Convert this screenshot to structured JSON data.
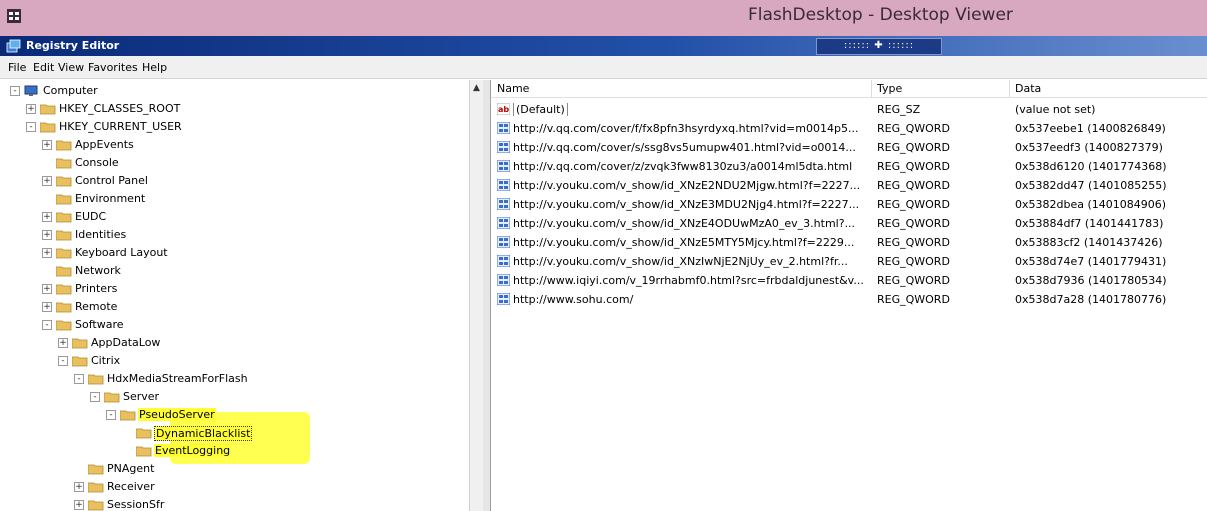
{
  "viewer": {
    "title": "FlashDesktop - Desktop Viewer",
    "controls": ":::::: ✚ ::::::"
  },
  "window": {
    "title": "Registry Editor"
  },
  "menu": [
    "File",
    "Edit",
    "View",
    "Favorites",
    "Help"
  ],
  "tree": [
    {
      "label": "Computer",
      "expander": "-",
      "level": 0,
      "icon": "computer-icon"
    },
    {
      "label": "HKEY_CLASSES_ROOT",
      "expander": "+",
      "level": 1
    },
    {
      "label": "HKEY_CURRENT_USER",
      "expander": "-",
      "level": 1
    },
    {
      "label": "AppEvents",
      "expander": "+",
      "level": 2
    },
    {
      "label": "Console",
      "expander": "",
      "level": 2
    },
    {
      "label": "Control Panel",
      "expander": "+",
      "level": 2
    },
    {
      "label": "Environment",
      "expander": "",
      "level": 2
    },
    {
      "label": "EUDC",
      "expander": "+",
      "level": 2
    },
    {
      "label": "Identities",
      "expander": "+",
      "level": 2
    },
    {
      "label": "Keyboard Layout",
      "expander": "+",
      "level": 2
    },
    {
      "label": "Network",
      "expander": "",
      "level": 2
    },
    {
      "label": "Printers",
      "expander": "+",
      "level": 2
    },
    {
      "label": "Remote",
      "expander": "+",
      "level": 2
    },
    {
      "label": "Software",
      "expander": "-",
      "level": 2
    },
    {
      "label": "AppDataLow",
      "expander": "+",
      "level": 3
    },
    {
      "label": "Citrix",
      "expander": "-",
      "level": 3
    },
    {
      "label": "HdxMediaStreamForFlash",
      "expander": "-",
      "level": 4
    },
    {
      "label": "Server",
      "expander": "-",
      "level": 5
    },
    {
      "label": "PseudoServer",
      "expander": "-",
      "level": 6,
      "highlight": true
    },
    {
      "label": "DynamicBlacklist",
      "expander": "",
      "level": 7,
      "highlight": true,
      "selected": true
    },
    {
      "label": "EventLogging",
      "expander": "",
      "level": 7,
      "highlight": true
    },
    {
      "label": "PNAgent",
      "expander": "",
      "level": 4
    },
    {
      "label": "Receiver",
      "expander": "+",
      "level": 4
    },
    {
      "label": "SessionSfr",
      "expander": "+",
      "level": 4
    }
  ],
  "list": {
    "columns": [
      "Name",
      "Type",
      "Data"
    ],
    "rows": [
      {
        "icon": "string-value-icon",
        "name": "(Default)",
        "type": "REG_SZ",
        "data": "(value not set)"
      },
      {
        "icon": "binary-value-icon",
        "name": "http://v.qq.com/cover/f/fx8pfn3hsyrdyxq.html?vid=m0014p5...",
        "type": "REG_QWORD",
        "data": "0x537eebe1 (1400826849)"
      },
      {
        "icon": "binary-value-icon",
        "name": "http://v.qq.com/cover/s/ssg8vs5umupw401.html?vid=o0014...",
        "type": "REG_QWORD",
        "data": "0x537eedf3 (1400827379)"
      },
      {
        "icon": "binary-value-icon",
        "name": "http://v.qq.com/cover/z/zvqk3fww8130zu3/a0014ml5dta.html",
        "type": "REG_QWORD",
        "data": "0x538d6120 (1401774368)"
      },
      {
        "icon": "binary-value-icon",
        "name": "http://v.youku.com/v_show/id_XNzE2NDU2Mjgw.html?f=2227...",
        "type": "REG_QWORD",
        "data": "0x5382dd47 (1401085255)"
      },
      {
        "icon": "binary-value-icon",
        "name": "http://v.youku.com/v_show/id_XNzE3MDU2Njg4.html?f=2227...",
        "type": "REG_QWORD",
        "data": "0x5382dbea (1401084906)"
      },
      {
        "icon": "binary-value-icon",
        "name": "http://v.youku.com/v_show/id_XNzE4ODUwMzA0_ev_3.html?...",
        "type": "REG_QWORD",
        "data": "0x53884df7 (1401441783)"
      },
      {
        "icon": "binary-value-icon",
        "name": "http://v.youku.com/v_show/id_XNzE5MTY5Mjcy.html?f=2229...",
        "type": "REG_QWORD",
        "data": "0x53883cf2 (1401437426)"
      },
      {
        "icon": "binary-value-icon",
        "name": "http://v.youku.com/v_show/id_XNzIwNjE2NjUy_ev_2.html?fr...",
        "type": "REG_QWORD",
        "data": "0x538d74e7 (1401779431)"
      },
      {
        "icon": "binary-value-icon",
        "name": "http://www.iqiyi.com/v_19rrhabmf0.html?src=frbdaldjunest&v...",
        "type": "REG_QWORD",
        "data": "0x538d7936 (1401780534)"
      },
      {
        "icon": "binary-value-icon",
        "name": "http://www.sohu.com/",
        "type": "REG_QWORD",
        "data": "0x538d7a28 (1401780776)"
      }
    ]
  },
  "colors": {
    "viewer_bar": "#d8a7c0",
    "titlebar": "#0a2a78",
    "highlight": "#ffff33",
    "folder": "#e8c060"
  }
}
